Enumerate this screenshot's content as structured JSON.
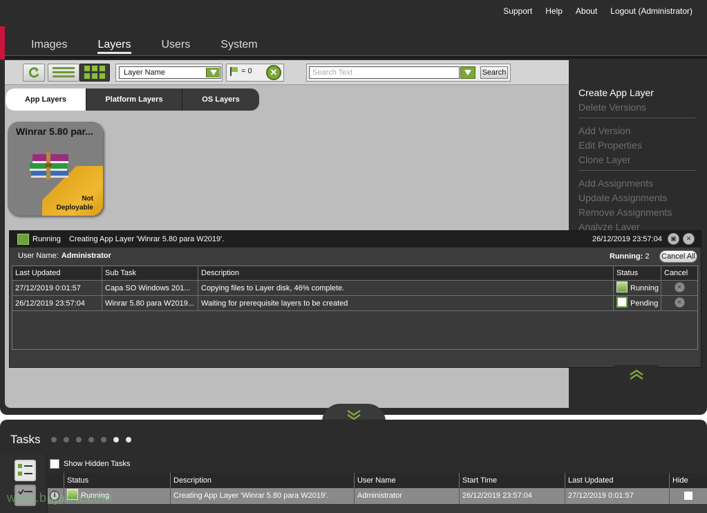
{
  "top_links": [
    "Support",
    "Help",
    "About",
    "Logout (Administrator)"
  ],
  "nav_tabs": [
    "Images",
    "Layers",
    "Users",
    "System"
  ],
  "nav_active": "Layers",
  "toolbar": {
    "sort_field": "Layer Name",
    "filter_count": "= 0",
    "search_placeholder": "Search Text",
    "search_label": "Search"
  },
  "layer_tabs": [
    "App Layers",
    "Platform Layers",
    "OS Layers"
  ],
  "layer_tile": {
    "title": "Winrar 5.80 par...",
    "status_line1": "Not",
    "status_line2": "Deployable",
    "icon": "winrar-books-icon"
  },
  "actions": {
    "group1": [
      {
        "label": "Create App Layer",
        "enabled": true
      },
      {
        "label": "Delete Versions",
        "enabled": false
      }
    ],
    "group2": [
      {
        "label": "Add Version",
        "enabled": false
      },
      {
        "label": "Edit Properties",
        "enabled": false
      },
      {
        "label": "Clone Layer",
        "enabled": false
      }
    ],
    "group3": [
      {
        "label": "Add Assignments",
        "enabled": false
      },
      {
        "label": "Update Assignments",
        "enabled": false
      },
      {
        "label": "Remove Assignments",
        "enabled": false
      },
      {
        "label": "Analyze Layer",
        "enabled": false
      }
    ]
  },
  "task_panel": {
    "status": "Running",
    "message": "Creating App Layer 'Winrar 5.80 para W2019'.",
    "timestamp": "26/12/2019 23:57:04",
    "user_label": "User Name:",
    "user_value": "Administrator",
    "running_label": "Running:",
    "running_count": "2",
    "cancel_all": "Cancel All",
    "columns": [
      "Last Updated",
      "Sub Task",
      "Description",
      "Status",
      "Cancel"
    ],
    "rows": [
      {
        "last_updated": "27/12/2019 0:01:57",
        "sub_task": "Capa SO Windows 201...",
        "description": "Copying files to Layer disk, 46% complete.",
        "status": "Running"
      },
      {
        "last_updated": "26/12/2019 23:57:04",
        "sub_task": "Winrar 5.80 para W2019...",
        "description": "Waiting for prerequisite layers to be created",
        "status": "Pending"
      }
    ]
  },
  "tasks": {
    "title": "Tasks",
    "show_hidden_label": "Show Hidden Tasks",
    "columns": [
      "Status",
      "Description",
      "User Name",
      "Start Time",
      "Last Updated",
      "Hide"
    ],
    "rows": [
      {
        "status": "Running",
        "description": "Creating App Layer 'Winrar 5.80 para W2019'.",
        "user": "Administrator",
        "start_time": "26/12/2019 23:57:04",
        "last_updated": "27/12/2019 0:01:57"
      }
    ]
  },
  "watermark": "www.bujarra.com",
  "colors": {
    "accent_green": "#7da63b",
    "brand_red": "#c8143c",
    "frame_dark": "#2c2c2c"
  }
}
